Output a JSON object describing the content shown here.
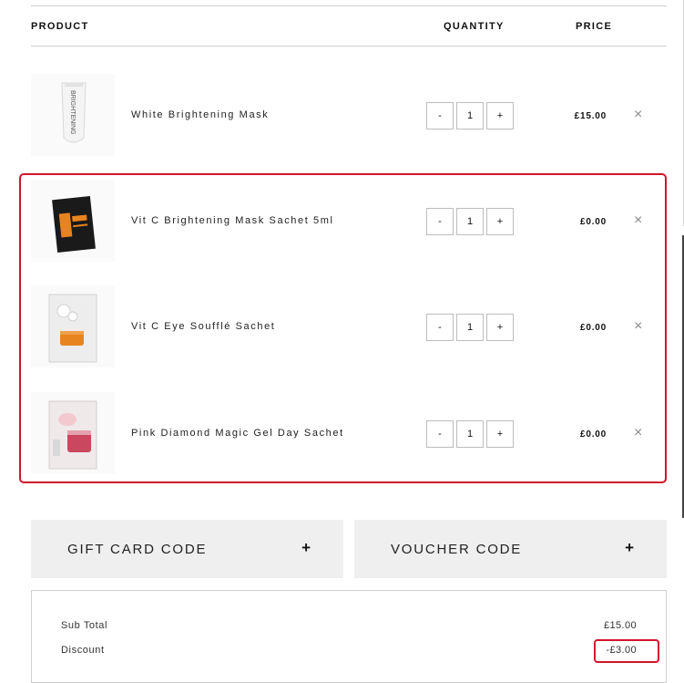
{
  "table_header": {
    "product": "PRODUCT",
    "quantity": "QUANTITY",
    "price": "PRICE"
  },
  "items": [
    {
      "name": "White Brightening Mask",
      "quantity": "1",
      "price": "£15.00",
      "minus": "-",
      "plus": "+",
      "remove": "×",
      "thumb_text": "BRIGHTENING"
    },
    {
      "name": "Vit C Brightening Mask Sachet 5ml",
      "quantity": "1",
      "price": "£0.00",
      "minus": "-",
      "plus": "+",
      "remove": "×"
    },
    {
      "name": "Vit C Eye Soufflé Sachet",
      "quantity": "1",
      "price": "£0.00",
      "minus": "-",
      "plus": "+",
      "remove": "×"
    },
    {
      "name": "Pink Diamond Magic Gel Day Sachet",
      "quantity": "1",
      "price": "£0.00",
      "minus": "-",
      "plus": "+",
      "remove": "×"
    }
  ],
  "codes": {
    "gift_card": {
      "label": "GIFT CARD CODE",
      "toggle": "+"
    },
    "voucher": {
      "label": "VOUCHER CODE",
      "toggle": "+"
    }
  },
  "summary": {
    "subtotal_label": "Sub Total",
    "subtotal_value": "£15.00",
    "discount_label": "Discount",
    "discount_value": "-£3.00"
  },
  "colors": {
    "highlight": "#d0152c",
    "panel": "#efefef",
    "accent_orange": "#e8841f"
  }
}
